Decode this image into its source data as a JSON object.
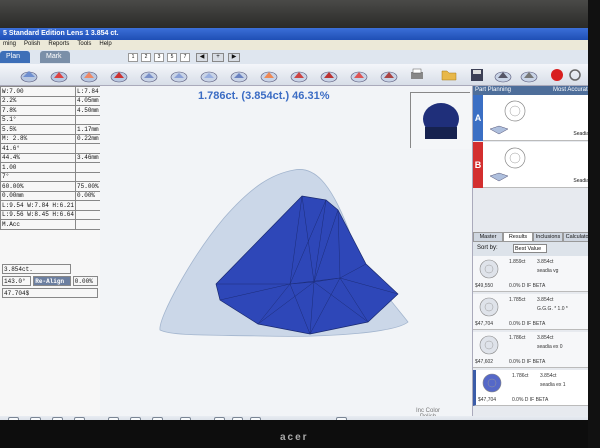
{
  "window": {
    "title": "5 Standard Edition Lens 1      3.854 ct."
  },
  "menu": [
    "ming",
    "Polish",
    "Reports",
    "Tools",
    "Help"
  ],
  "tabs": [
    {
      "label": "Plan"
    },
    {
      "label": "Mark"
    }
  ],
  "view_buttons": [
    "1",
    "2",
    "3",
    "5",
    "7"
  ],
  "headline": "1.786ct. (3.854ct.) 46.31%",
  "params": [
    [
      "W:7.00",
      "L:7.84"
    ],
    [
      "2.2%",
      "4.05mm"
    ],
    [
      "7.8%",
      "4.50mm"
    ],
    [
      "5.1°",
      ""
    ],
    [
      "5.5%",
      "1.17mm"
    ],
    [
      "M: 2.8%",
      "0.22mm"
    ],
    [
      "41.6°",
      ""
    ],
    [
      "44.4%",
      "3.46mm"
    ],
    [
      "1.00",
      ""
    ],
    [
      "7°",
      ""
    ],
    [
      "60.00%",
      "75.00%"
    ],
    [
      "0.00mm",
      "0.00%"
    ],
    [
      "L:9.54 W:7.84 H:6.21",
      ""
    ],
    [
      "L:9.56 W:8.45 H:6.64",
      ""
    ],
    [
      "M.Acc",
      ""
    ]
  ],
  "summary": {
    "weight": "3.854ct.",
    "value": "143.0°",
    "realign": "Re-Align",
    "realign_pct": "0.00%",
    "price": "47.704$"
  },
  "right_panel": {
    "title": "Part Planning",
    "accuracy": "Most Accurate",
    "plans": [
      {
        "letter": "A",
        "name": "Seadia"
      },
      {
        "letter": "B",
        "name": "Seadia"
      }
    ],
    "tabs": [
      "Master",
      "Results",
      "Inclusions",
      "Calculator"
    ],
    "sort_label": "Sort by:",
    "sort_value": "Best Value",
    "results": [
      {
        "price": "$49,550",
        "c1": "1.859ct",
        "c2": "3.854ct",
        "name": "seadia vg",
        "stats": "0.0%  D  IF  BETA"
      },
      {
        "price": "$47,704",
        "c1": "1.785ct",
        "c2": "3.854ct",
        "name": "G.G.G. * 1.0 *",
        "stats": "0.0%  D  IF  BETA"
      },
      {
        "price": "$47,602",
        "c1": "1.786ct",
        "c2": "3.854ct",
        "name": "seadia ex 0",
        "stats": "0.0%  D  IF  BETA"
      },
      {
        "price": "$47,704",
        "c1": "1.786ct",
        "c2": "3.854ct",
        "name": "seadia ex 1",
        "stats": "0.0%  D  IF  BETA"
      }
    ]
  },
  "color_label": {
    "line1": "Inc Color",
    "line2": "Polish"
  },
  "brand": "acer",
  "colors": {
    "accent": "#3b6cc4",
    "gem": "#2e47b8",
    "rough": "#c9d6e8",
    "planA": "#3b6fc4",
    "planB": "#d32f2f"
  }
}
